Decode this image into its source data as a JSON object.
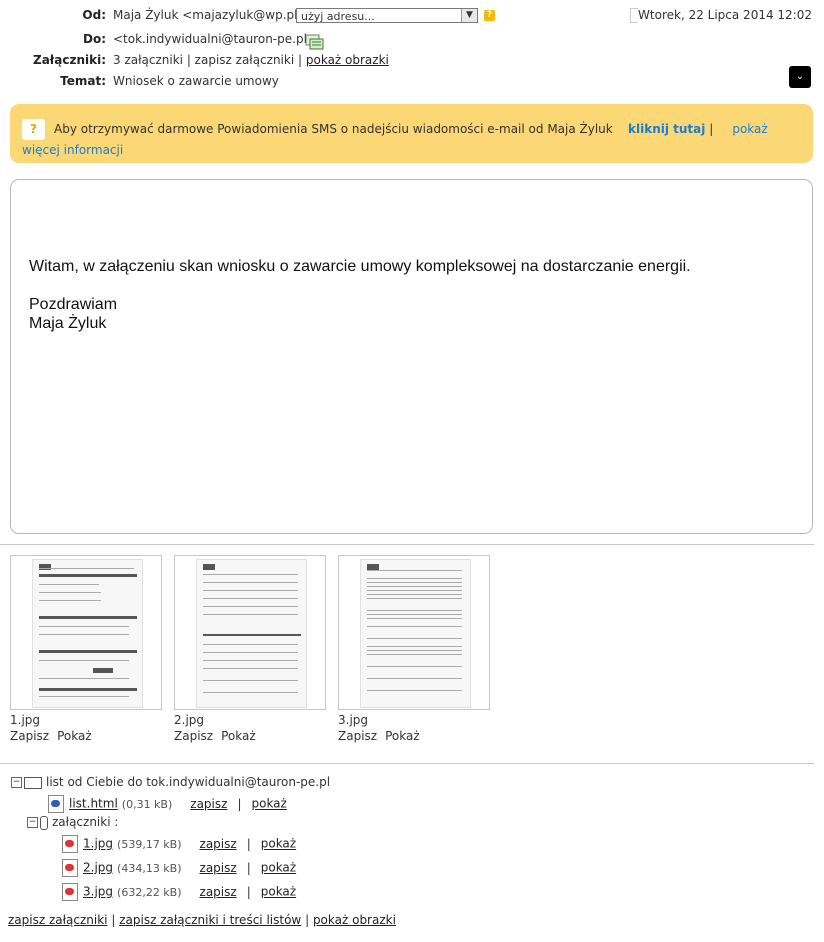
{
  "header": {
    "from_label": "Od:",
    "from_value": "Maja Żyluk <majazyluk@wp.pl>",
    "address_select": "użyj adresu...",
    "to_label": "Do:",
    "to_value": "<tok.indywidualni@tauron-pe.pl>",
    "attachments_label": "Załączniki:",
    "attachments_count": "3 załączniki",
    "save_attachments": "zapisz załączniki",
    "show_images": "pokaż obrazki",
    "subject_label": "Temat:",
    "subject_value": "Wniosek o zawarcie umowy",
    "date": "Wtorek, 22 Lipca 2014 12:02"
  },
  "banner": {
    "text": "Aby otrzymywać darmowe Powiadomienia SMS o nadejściu wiadomości e-mail od Maja Żyluk",
    "click_here": "kliknij tutaj",
    "sep": "|",
    "more_info": "pokaż więcej informacji"
  },
  "message": {
    "line1": "Witam, w załączeniu skan wniosku o zawarcie umowy kompleksowej na dostarczanie energii.",
    "line2": "Pozdrawiam",
    "line3": "Maja Żyluk"
  },
  "thumbnails": [
    {
      "name": "1.jpg",
      "save": "Zapisz",
      "show": "Pokaż"
    },
    {
      "name": "2.jpg",
      "save": "Zapisz",
      "show": "Pokaż"
    },
    {
      "name": "3.jpg",
      "save": "Zapisz",
      "show": "Pokaż"
    }
  ],
  "tree": {
    "root_label": "list od Ciebie do tok.indywidualni@tauron-pe.pl",
    "html_file": {
      "name": "list.html",
      "size": "(0,31 kB)",
      "save": "zapisz",
      "show": "pokaż"
    },
    "attachments_label": "załączniki :",
    "files": [
      {
        "name": "1.jpg",
        "size": "(539,17 kB)",
        "save": "zapisz",
        "show": "pokaż"
      },
      {
        "name": "2.jpg",
        "size": "(434,13 kB)",
        "save": "zapisz",
        "show": "pokaż"
      },
      {
        "name": "3.jpg",
        "size": "(632,22 kB)",
        "save": "zapisz",
        "show": "pokaż"
      }
    ],
    "pipe": "|"
  },
  "footer": {
    "save_attachments": "zapisz załączniki",
    "save_all": "zapisz załączniki i treści listów",
    "show_images": "pokaż obrazki",
    "pipe": "|"
  },
  "colors": {
    "banner_bg": "#fbd775",
    "link_blue": "#1a7ed3",
    "accent_yellow": "#f6b800"
  }
}
